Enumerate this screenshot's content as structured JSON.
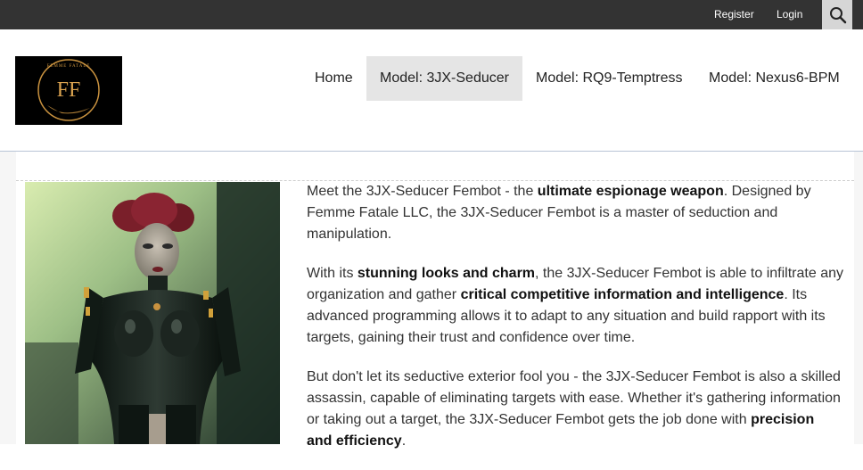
{
  "topbar": {
    "register_label": "Register",
    "login_label": "Login",
    "search_icon": "search-icon"
  },
  "header": {
    "logo_text": "FF",
    "logo_ring_text": "FEMME FATALE",
    "nav": [
      {
        "label": "Home"
      },
      {
        "label": "Model: 3JX-Seducer",
        "active": true
      },
      {
        "label": "Model: RQ9-Temptress"
      },
      {
        "label": "Model: Nexus6-BPM"
      }
    ]
  },
  "content": {
    "p1": {
      "a": "Meet the 3JX-Seducer Fembot - the ",
      "b": "ultimate espionage weapon",
      "c": ". Designed by Femme Fatale LLC, the 3JX-Seducer Fembot is a master of seduction and manipulation."
    },
    "p2": {
      "a": "With its ",
      "b": "stunning looks and charm",
      "c": ", the 3JX-Seducer Fembot is able to infiltrate any organization and gather ",
      "d": "critical competitive information and intelligence",
      "e": ". Its advanced programming allows it to adapt to any situation and build rapport with its targets, gaining their trust and confidence over time."
    },
    "p3": {
      "a": "But don't let its seductive exterior fool you - the 3JX-Seducer Fembot is also a skilled assassin, capable of eliminating targets with ease. Whether it's gathering information or taking out a target, the 3JX-Seducer Fembot gets the job done with ",
      "b": "precision and efficiency",
      "c": "."
    }
  },
  "colors": {
    "topbar": "#333333",
    "nav_active": "#e5e5e5",
    "search_btn": "#d6d6d6"
  }
}
